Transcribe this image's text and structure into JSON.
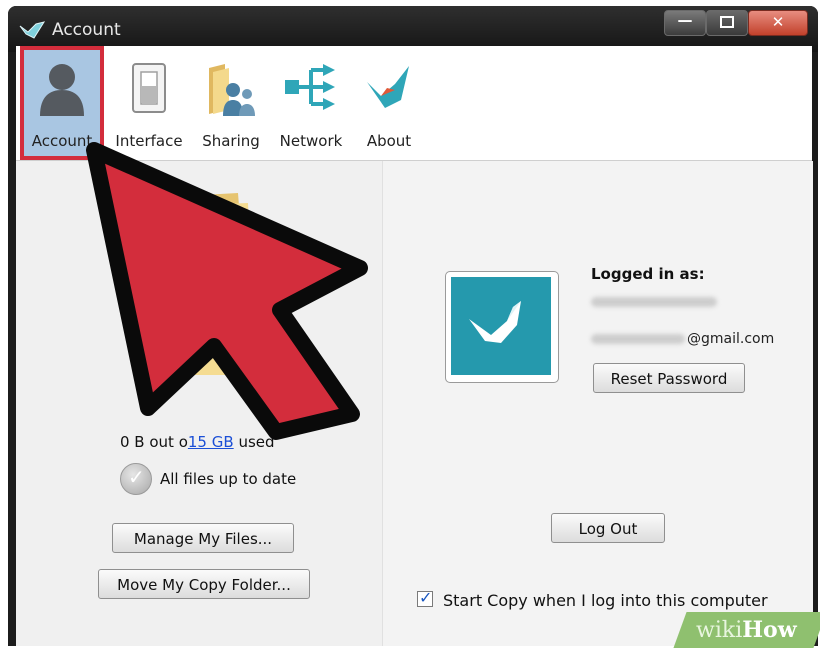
{
  "window": {
    "title": "Account",
    "controls": {
      "minimize": "—",
      "maximize": "",
      "close": "✕"
    }
  },
  "toolbar": {
    "items": [
      {
        "label": "Account",
        "icon": "user-silhouette-icon",
        "active": true
      },
      {
        "label": "Interface",
        "icon": "toggle-switch-icon",
        "active": false
      },
      {
        "label": "Sharing",
        "icon": "shared-folder-icon",
        "active": false
      },
      {
        "label": "Network",
        "icon": "network-icon",
        "active": false
      },
      {
        "label": "About",
        "icon": "copy-logo-icon",
        "active": false
      }
    ]
  },
  "left_panel": {
    "usage_prefix": "0 B out o",
    "usage_link": "15 GB",
    "usage_suffix": " used",
    "sync_status": "All files up to date",
    "manage_files_button": "Manage My Files...",
    "move_folder_button": "Move My Copy Folder..."
  },
  "right_panel": {
    "logged_in_label": "Logged in as:",
    "email_domain": "@gmail.com",
    "reset_password_button": "Reset Password",
    "log_out_button": "Log Out",
    "start_on_login_label": "Start Copy when I log into this computer",
    "start_on_login_checked": true
  },
  "watermark": {
    "part1": "wiki",
    "part2": "How"
  },
  "colors": {
    "accent_blue": "#2599ad",
    "selection_highlight": "#a9c6e2",
    "annotation_red": "#d32d3c",
    "link_blue": "#1b4fd6"
  }
}
